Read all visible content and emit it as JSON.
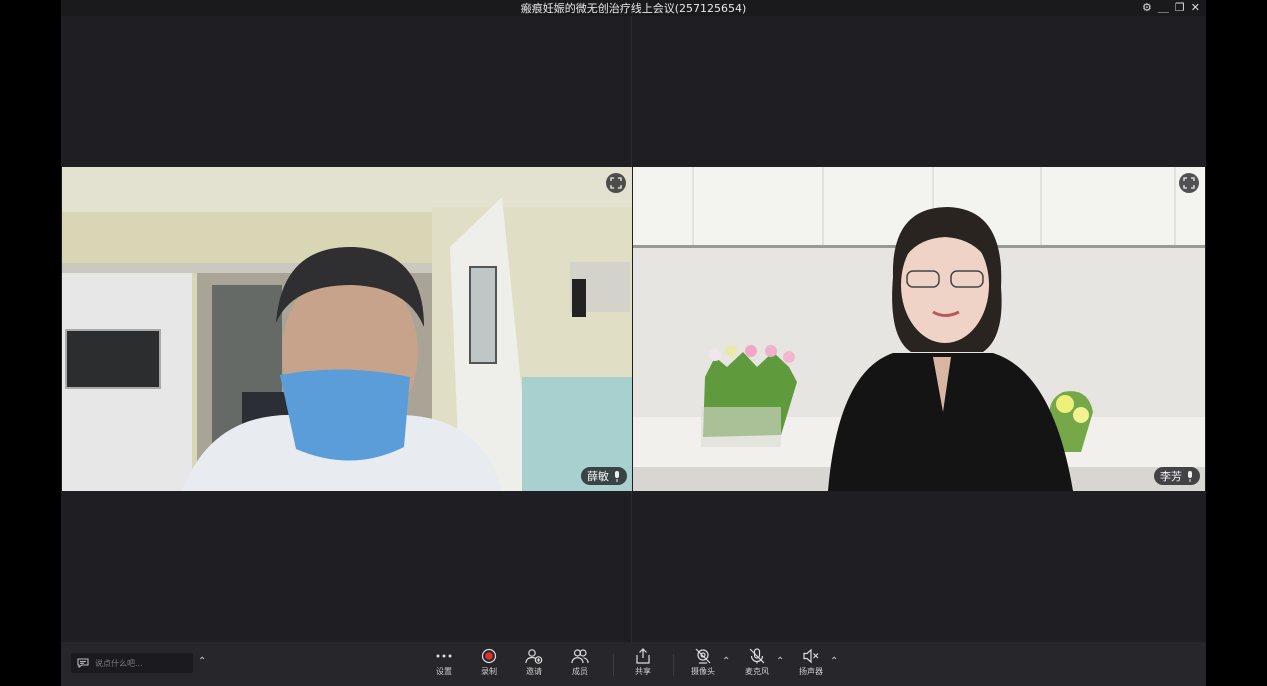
{
  "window": {
    "title": "瘢痕妊娠的微无创治疗线上会议(257125654)",
    "controls": [
      "settings-icon",
      "minimize-icon",
      "restore-icon",
      "close-icon"
    ]
  },
  "participants": [
    {
      "name": "薛敏",
      "mic_icon": "microphone-icon",
      "expand_icon": "fullscreen-icon"
    },
    {
      "name": "李芳",
      "mic_icon": "microphone-icon",
      "expand_icon": "fullscreen-icon"
    }
  ],
  "chat": {
    "placeholder": "说点什么吧..."
  },
  "toolbar": {
    "settings": "设置",
    "record": "录制",
    "invite": "邀请",
    "members": "成员",
    "share": "共享",
    "camera": "摄像头",
    "microphone": "麦克风",
    "speaker": "扬声器"
  },
  "colors": {
    "record_red": "#e0302d",
    "background": "#1f1f23",
    "toolbar": "#26262b"
  }
}
